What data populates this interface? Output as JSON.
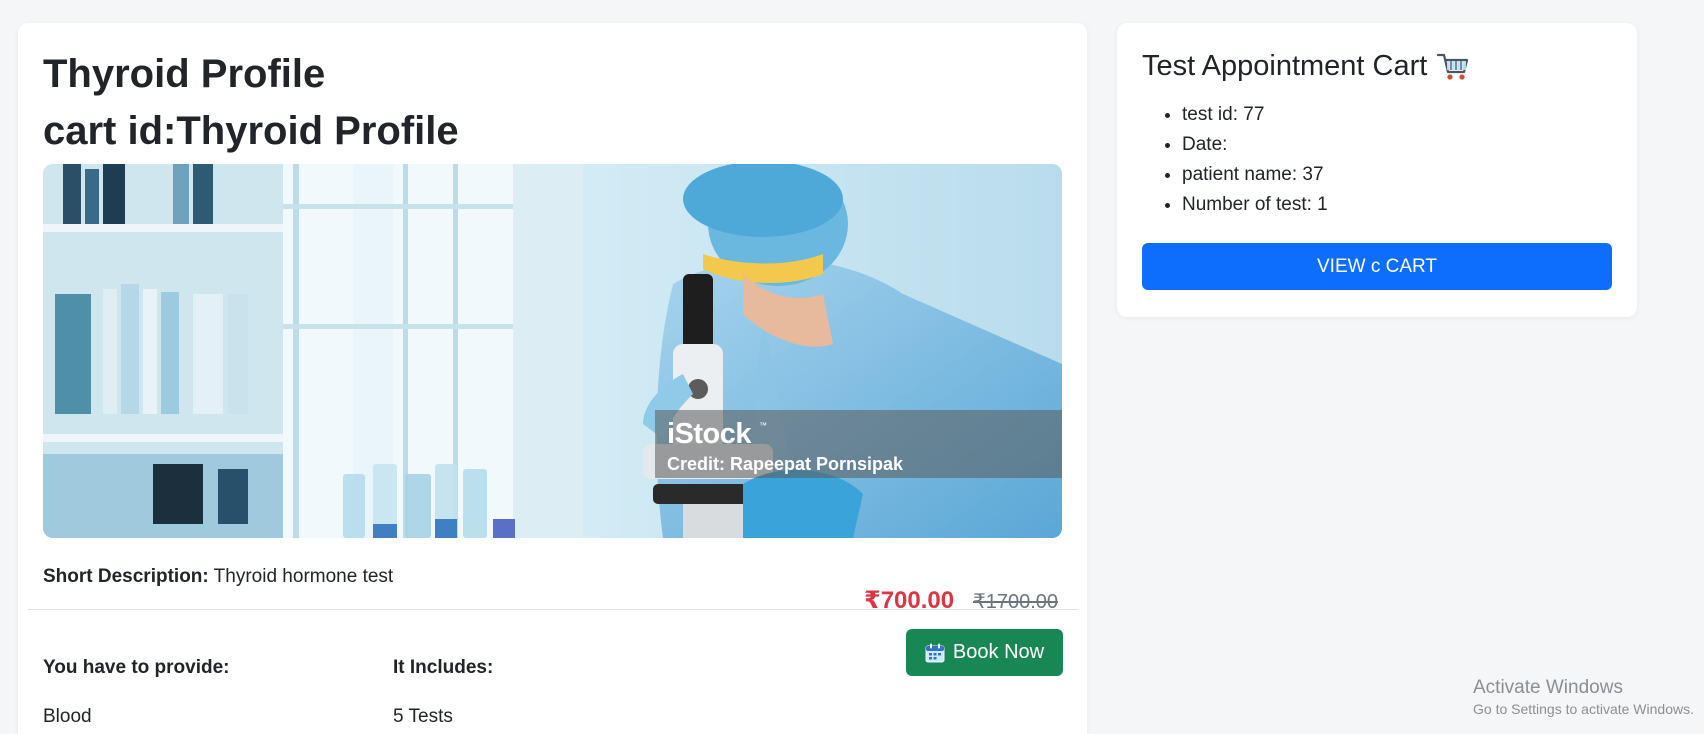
{
  "product": {
    "title": "Thyroid Profile",
    "cart_id_text": "cart id:Thyroid Profile",
    "image": {
      "watermark_logo": "iStock",
      "watermark_tm": "™",
      "credit": "Credit: Rapeepat Pornsipak"
    },
    "short_description_label": "Short Description:",
    "short_description_value": "Thyroid hormone test",
    "price_current": "₹700.00",
    "price_original": "₹1700.00",
    "provide_heading": "You have to provide:",
    "provide_value": "Blood",
    "includes_heading": "It Includes:",
    "includes_value": "5 Tests",
    "book_button_label": "Book Now",
    "book_icon": "calendar-icon"
  },
  "cart": {
    "title": "Test Appointment Cart",
    "title_icon": "shopping-cart-icon",
    "items": [
      {
        "label": "test id: 77"
      },
      {
        "label": "Date:"
      },
      {
        "label": "patient name: 37"
      },
      {
        "label": "Number of test: 1"
      }
    ],
    "view_button_label": "VIEW c CART"
  },
  "os_overlay": {
    "title": "Activate Windows",
    "subtitle": "Go to Settings to activate Windows."
  },
  "colors": {
    "page_bg": "#f5f6f8",
    "card_bg": "#ffffff",
    "price_red": "#dc3545",
    "book_green": "#198754",
    "view_blue": "#0d6efd"
  }
}
